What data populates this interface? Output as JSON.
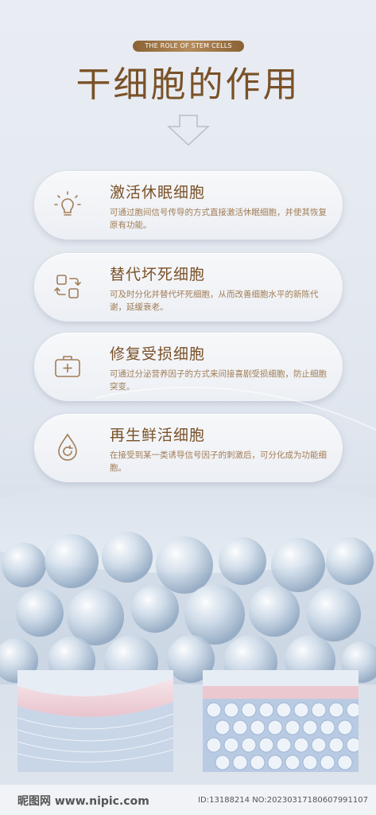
{
  "header": {
    "badge": "THE ROLE OF STEM CELLS",
    "title": "干细胞的作用"
  },
  "cards": [
    {
      "icon": "lightbulb-icon",
      "title": "激活休眠细胞",
      "desc": "可通过胞间信号传导的方式直接激活休眠细胞，并使其恢复原有功能。"
    },
    {
      "icon": "replace-icon",
      "title": "替代坏死细胞",
      "desc": "可及时分化并替代坏死细胞，从而改善细胞水平的新陈代谢，延缓衰老。"
    },
    {
      "icon": "first-aid-kit-icon",
      "title": "修复受损细胞",
      "desc": "可通过分泌营养因子的方式来间接喜剧受损细胞，防止细胞突变。"
    },
    {
      "icon": "droplet-refresh-icon",
      "title": "再生鲜活细胞",
      "desc": "在接受到某一类诱导信号因子的刺激后，可分化成为功能细胞。"
    }
  ],
  "watermark": {
    "left": "昵图网 www.nipic.com",
    "right": "ID:13188214 NO:20230317180607991107"
  },
  "colors": {
    "accent": "#7a5128",
    "text": "#a27d56",
    "background": "#e4e9f0"
  }
}
